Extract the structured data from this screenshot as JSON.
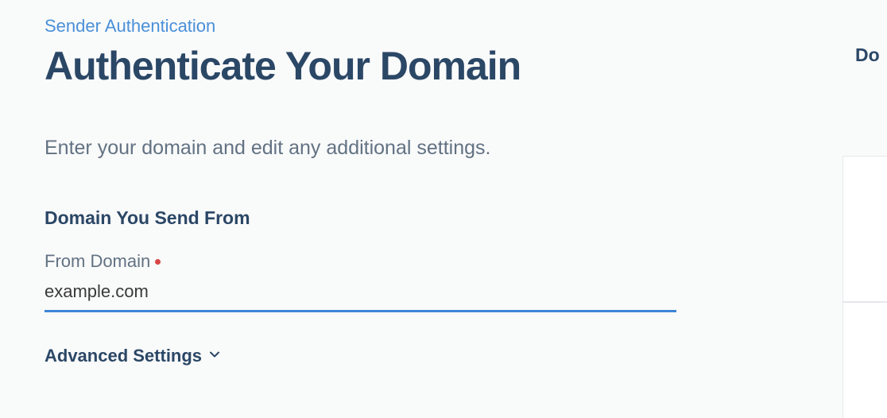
{
  "breadcrumb": "Sender Authentication",
  "page_title": "Authenticate Your Domain",
  "subtitle": "Enter your domain and edit any additional settings.",
  "form": {
    "section_title": "Domain You Send From",
    "from_domain_label": "From Domain",
    "from_domain_value": "example.com"
  },
  "advanced_label": "Advanced Settings",
  "side_text": "Do"
}
